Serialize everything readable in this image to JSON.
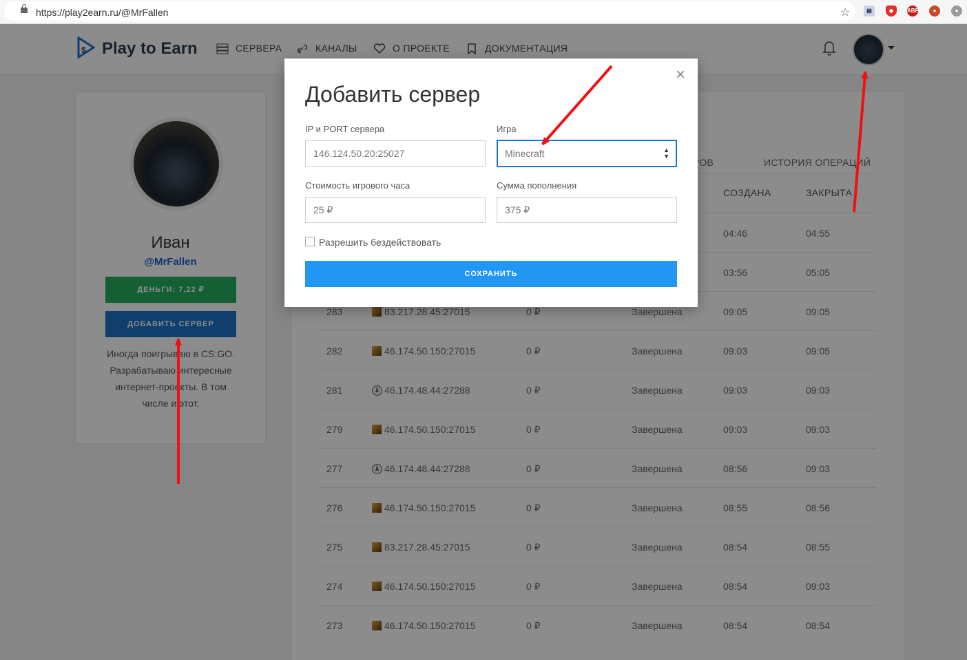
{
  "browser": {
    "url": "https://play2earn.ru/@MrFallen",
    "extensions": [
      "flag-icon",
      "shield-icon",
      "abp-icon",
      "puzzle-icon",
      "profile-icon"
    ],
    "abp_label": "ABP"
  },
  "header": {
    "logo_text": "Play to Earn",
    "nav": [
      {
        "label": "СЕРВЕРА",
        "icon": "servers-icon"
      },
      {
        "label": "КАНАЛЫ",
        "icon": "link-icon"
      },
      {
        "label": "О ПРОЕКТЕ",
        "icon": "heart-icon"
      },
      {
        "label": "ДОКУМЕНТАЦИЯ",
        "icon": "bookmark-icon"
      }
    ]
  },
  "profile": {
    "name": "Иван",
    "handle": "@MrFallen",
    "money_button": "ДЕНЬГИ: 7,22 ₽",
    "add_server_button": "ДОБАВИТЬ СЕРВЕР",
    "bio": "Иногда поигрываю в CS:GO. Разрабатываю интересные интернет-проекты. В том числе и этот."
  },
  "panel": {
    "tabs": [
      "РОВ",
      "ИСТОРИЯ ОПЕРАЦИЙ"
    ],
    "columns": {
      "created": "СОЗДАНА",
      "closed": "ЗАКРЫТА"
    },
    "rows": [
      {
        "id": "",
        "game": "",
        "server": "",
        "cost": "",
        "status": "",
        "created": "04:46",
        "closed": "04:55"
      },
      {
        "id": "",
        "game": "",
        "server": "",
        "cost": "",
        "status": "",
        "created": "03:56",
        "closed": "05:05"
      },
      {
        "id": "283",
        "game": "cs",
        "server": "83.217.28.45:27015",
        "cost": "0 ₽",
        "status": "Завершена",
        "created": "09:05",
        "closed": "09:05"
      },
      {
        "id": "282",
        "game": "cs",
        "server": "46.174.50.150:27015",
        "cost": "0 ₽",
        "status": "Завершена",
        "created": "09:03",
        "closed": "09:05"
      },
      {
        "id": "281",
        "game": "hl",
        "server": "46.174.48.44:27288",
        "cost": "0 ₽",
        "status": "Завершена",
        "created": "09:03",
        "closed": "09:03"
      },
      {
        "id": "279",
        "game": "cs",
        "server": "46.174.50.150:27015",
        "cost": "0 ₽",
        "status": "Завершена",
        "created": "09:03",
        "closed": "09:03"
      },
      {
        "id": "277",
        "game": "hl",
        "server": "46.174.48.44:27288",
        "cost": "0 ₽",
        "status": "Завершена",
        "created": "08:56",
        "closed": "09:03"
      },
      {
        "id": "276",
        "game": "cs",
        "server": "46.174.50.150:27015",
        "cost": "0 ₽",
        "status": "Завершена",
        "created": "08:55",
        "closed": "08:56"
      },
      {
        "id": "275",
        "game": "cs",
        "server": "83.217.28.45:27015",
        "cost": "0 ₽",
        "status": "Завершена",
        "created": "08:54",
        "closed": "08:55"
      },
      {
        "id": "274",
        "game": "cs",
        "server": "46.174.50.150:27015",
        "cost": "0 ₽",
        "status": "Завершена",
        "created": "08:54",
        "closed": "09:03"
      },
      {
        "id": "273",
        "game": "cs",
        "server": "46.174.50.150:27015",
        "cost": "0 ₽",
        "status": "Завершена",
        "created": "08:54",
        "closed": "08:54"
      }
    ]
  },
  "modal": {
    "title": "Добавить сервер",
    "close": "×",
    "ip_label": "IP и PORT сервера",
    "ip_value": "146.124.50.20:25027",
    "game_label": "Игра",
    "game_value": "Minecraft",
    "cost_label": "Стоимость игрового часа",
    "cost_value": "25 ₽",
    "sum_label": "Сумма пополнения",
    "sum_value": "375 ₽",
    "idle_label": "Разрешить бездействовать",
    "idle_checked": false,
    "save_button": "СОХРАНИТЬ"
  },
  "colors": {
    "brand": "#2d3e50",
    "money": "#27ae60",
    "add_server": "#1e73c8",
    "save": "#2196f3",
    "annotation_arrow": "#ee1111"
  }
}
